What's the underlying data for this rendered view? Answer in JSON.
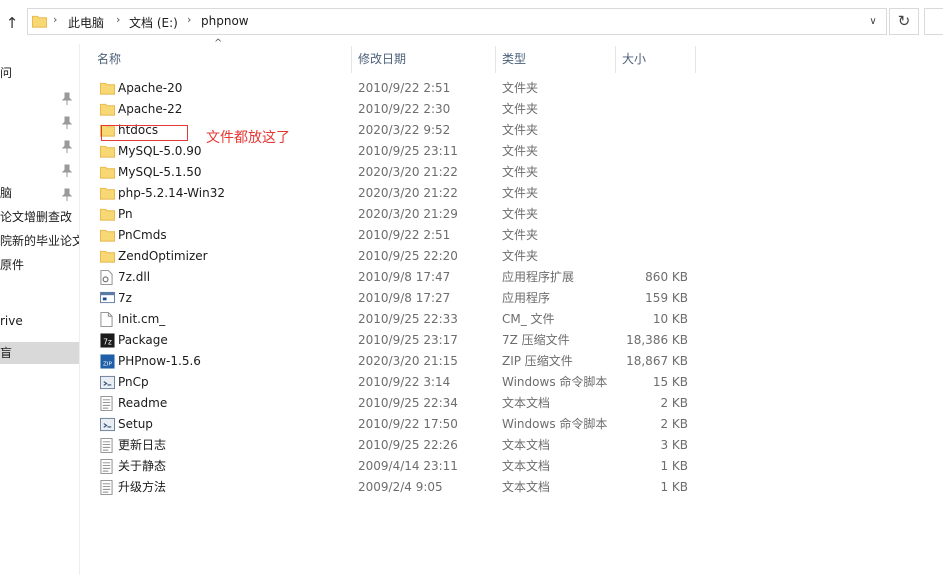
{
  "address": {
    "crumbs": [
      "此电脑",
      "文档 (E:)",
      "phpnow"
    ]
  },
  "nav": {
    "items": [
      "问",
      "",
      "",
      "",
      "脑",
      "论文增删查改",
      "院新的毕业论文",
      "原件",
      "",
      "rive",
      "盲"
    ]
  },
  "columns": {
    "name": "名称",
    "date": "修改日期",
    "type": "类型",
    "size": "大小"
  },
  "files": [
    {
      "name": "Apache-20",
      "date": "2010/9/22 2:51",
      "type": "文件夹",
      "size": "",
      "icon": "folder"
    },
    {
      "name": "Apache-22",
      "date": "2010/9/22 2:30",
      "type": "文件夹",
      "size": "",
      "icon": "folder"
    },
    {
      "name": "htdocs",
      "date": "2020/3/22 9:52",
      "type": "文件夹",
      "size": "",
      "icon": "folder"
    },
    {
      "name": "MySQL-5.0.90",
      "date": "2010/9/25 23:11",
      "type": "文件夹",
      "size": "",
      "icon": "folder"
    },
    {
      "name": "MySQL-5.1.50",
      "date": "2020/3/20 21:22",
      "type": "文件夹",
      "size": "",
      "icon": "folder"
    },
    {
      "name": "php-5.2.14-Win32",
      "date": "2020/3/20 21:22",
      "type": "文件夹",
      "size": "",
      "icon": "folder"
    },
    {
      "name": "Pn",
      "date": "2020/3/20 21:29",
      "type": "文件夹",
      "size": "",
      "icon": "folder"
    },
    {
      "name": "PnCmds",
      "date": "2010/9/22 2:51",
      "type": "文件夹",
      "size": "",
      "icon": "folder"
    },
    {
      "name": "ZendOptimizer",
      "date": "2010/9/25 22:20",
      "type": "文件夹",
      "size": "",
      "icon": "folder"
    },
    {
      "name": "7z.dll",
      "date": "2010/9/8 17:47",
      "type": "应用程序扩展",
      "size": "860 KB",
      "icon": "dll"
    },
    {
      "name": "7z",
      "date": "2010/9/8 17:27",
      "type": "应用程序",
      "size": "159 KB",
      "icon": "exe"
    },
    {
      "name": "Init.cm_",
      "date": "2010/9/25 22:33",
      "type": "CM_ 文件",
      "size": "10 KB",
      "icon": "file"
    },
    {
      "name": "Package",
      "date": "2010/9/25 23:17",
      "type": "7Z 压缩文件",
      "size": "18,386 KB",
      "icon": "7z"
    },
    {
      "name": "PHPnow-1.5.6",
      "date": "2020/3/20 21:15",
      "type": "ZIP 压缩文件",
      "size": "18,867 KB",
      "icon": "zip"
    },
    {
      "name": "PnCp",
      "date": "2010/9/22 3:14",
      "type": "Windows 命令脚本",
      "size": "15 KB",
      "icon": "cmd"
    },
    {
      "name": "Readme",
      "date": "2010/9/25 22:34",
      "type": "文本文档",
      "size": "2 KB",
      "icon": "txt"
    },
    {
      "name": "Setup",
      "date": "2010/9/22 17:50",
      "type": "Windows 命令脚本",
      "size": "2 KB",
      "icon": "cmd"
    },
    {
      "name": "更新日志",
      "date": "2010/9/25 22:26",
      "type": "文本文档",
      "size": "3 KB",
      "icon": "txt"
    },
    {
      "name": "关于静态",
      "date": "2009/4/14 23:11",
      "type": "文本文档",
      "size": "1 KB",
      "icon": "txt"
    },
    {
      "name": "升级方法",
      "date": "2009/2/4 9:05",
      "type": "文本文档",
      "size": "1 KB",
      "icon": "txt"
    }
  ],
  "annotation": "文件都放这了",
  "colors": {
    "folder": "#f8d775",
    "folder_dark": "#e8b84a",
    "annotation": "#e53935",
    "header_text": "#4c607a",
    "secondary_text": "#6d6d6d"
  }
}
